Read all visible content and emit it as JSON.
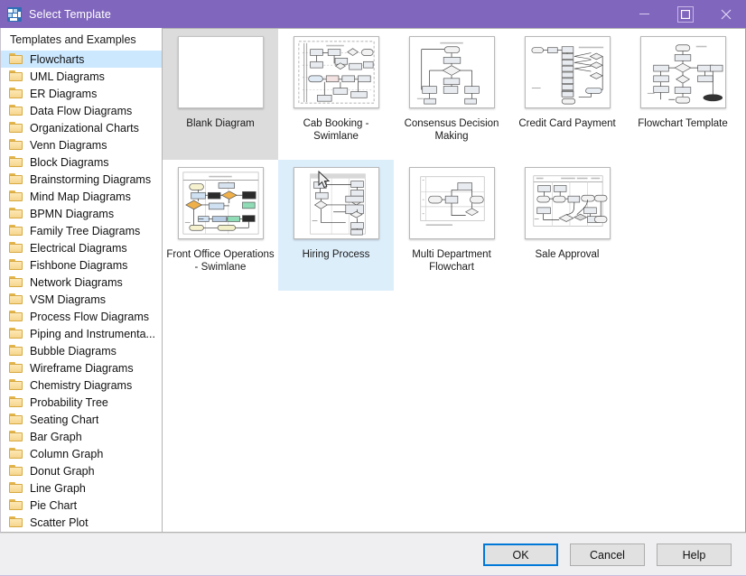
{
  "window": {
    "title": "Select Template",
    "app_icon": "template-grid-icon",
    "accent_color": "#8066bd",
    "controls": {
      "minimize": "minimize-icon",
      "maximize": "maximize-icon",
      "close": "close-icon"
    }
  },
  "sidebar": {
    "header": "Templates and Examples",
    "selected": "Flowcharts",
    "items": [
      {
        "label": "Flowcharts",
        "selected": true
      },
      {
        "label": "UML Diagrams",
        "selected": false
      },
      {
        "label": "ER Diagrams",
        "selected": false
      },
      {
        "label": "Data Flow Diagrams",
        "selected": false
      },
      {
        "label": "Organizational Charts",
        "selected": false
      },
      {
        "label": "Venn Diagrams",
        "selected": false
      },
      {
        "label": "Block Diagrams",
        "selected": false
      },
      {
        "label": "Brainstorming Diagrams",
        "selected": false
      },
      {
        "label": "Mind Map Diagrams",
        "selected": false
      },
      {
        "label": "BPMN Diagrams",
        "selected": false
      },
      {
        "label": "Family Tree Diagrams",
        "selected": false
      },
      {
        "label": "Electrical Diagrams",
        "selected": false
      },
      {
        "label": "Fishbone Diagrams",
        "selected": false
      },
      {
        "label": "Network Diagrams",
        "selected": false
      },
      {
        "label": "VSM Diagrams",
        "selected": false
      },
      {
        "label": "Process Flow Diagrams",
        "selected": false
      },
      {
        "label": "Piping and Instrumenta...",
        "selected": false
      },
      {
        "label": "Bubble Diagrams",
        "selected": false
      },
      {
        "label": "Wireframe Diagrams",
        "selected": false
      },
      {
        "label": "Chemistry Diagrams",
        "selected": false
      },
      {
        "label": "Probability Tree",
        "selected": false
      },
      {
        "label": "Seating Chart",
        "selected": false
      },
      {
        "label": "Bar Graph",
        "selected": false
      },
      {
        "label": "Column Graph",
        "selected": false
      },
      {
        "label": "Donut Graph",
        "selected": false
      },
      {
        "label": "Line Graph",
        "selected": false
      },
      {
        "label": "Pie Chart",
        "selected": false
      },
      {
        "label": "Scatter Plot",
        "selected": false
      }
    ]
  },
  "templates": {
    "items": [
      {
        "label": "Blank Diagram",
        "thumb": "blank",
        "state": "selected"
      },
      {
        "label": "Cab Booking - Swimlane",
        "thumb": "cab-booking",
        "state": "normal"
      },
      {
        "label": "Consensus Decision Making",
        "thumb": "consensus",
        "state": "normal"
      },
      {
        "label": "Credit Card Payment",
        "thumb": "credit-card",
        "state": "normal"
      },
      {
        "label": "Flowchart Template",
        "thumb": "flowchart-template",
        "state": "normal"
      },
      {
        "label": "Front Office Operations - Swimlane",
        "thumb": "front-office",
        "state": "normal"
      },
      {
        "label": "Hiring Process",
        "thumb": "hiring",
        "state": "hovered"
      },
      {
        "label": "Multi Department Flowchart",
        "thumb": "multi-dept",
        "state": "normal"
      },
      {
        "label": "Sale Approval",
        "thumb": "sale-approval",
        "state": "normal"
      }
    ]
  },
  "footer": {
    "ok_label": "OK",
    "cancel_label": "Cancel",
    "help_label": "Help"
  }
}
